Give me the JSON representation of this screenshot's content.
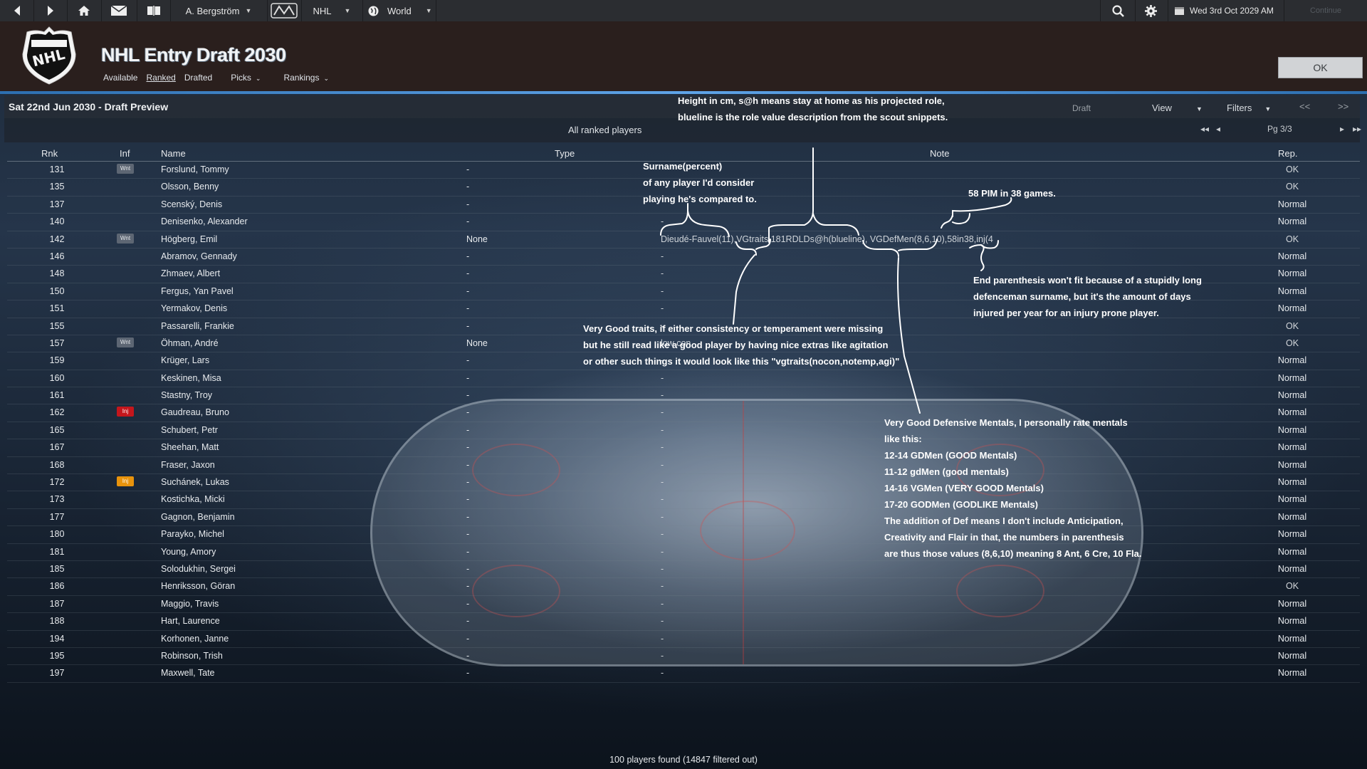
{
  "topbar": {
    "manager": "A. Bergström",
    "league": "NHL",
    "world": "World",
    "date": "Wed 3rd Oct 2029 AM",
    "continue": "Continue"
  },
  "header": {
    "title": "NHL Entry Draft 2030",
    "nav": [
      "Available",
      "Ranked",
      "Drafted",
      "Picks",
      "Rankings"
    ],
    "ok": "OK"
  },
  "panel": {
    "title": "Sat 22nd Jun 2030 - Draft Preview",
    "draft": "Draft",
    "view": "View",
    "filters": "Filters",
    "prev": "<<",
    "next": ">>",
    "subtitle": "All ranked players",
    "page": "Pg 3/3"
  },
  "columns": {
    "rank": "Rnk",
    "inf": "Inf",
    "name": "Name",
    "type": "Type",
    "note": "Note",
    "rep": "Rep."
  },
  "rows": [
    {
      "rank": "131",
      "inf": "Wnt",
      "name": "Forslund, Tommy",
      "type": "-",
      "note": "",
      "rep": "OK"
    },
    {
      "rank": "135",
      "inf": "",
      "name": "Olsson, Benny",
      "type": "-",
      "note": "",
      "rep": "OK"
    },
    {
      "rank": "137",
      "inf": "",
      "name": "Scenský, Denis",
      "type": "-",
      "note": "",
      "rep": "Normal"
    },
    {
      "rank": "140",
      "inf": "",
      "name": "Denisenko, Alexander",
      "type": "-",
      "note": "-",
      "rep": "Normal"
    },
    {
      "rank": "142",
      "inf": "Wnt",
      "name": "Högberg, Emil",
      "type": "None",
      "note": "Dieudé-Fauvel(11),VGtraits,181RDLDs@h(blueline), VGDefMen(8,6,10),58in38,inj(4",
      "rep": "OK"
    },
    {
      "rank": "146",
      "inf": "",
      "name": "Abramov, Gennady",
      "type": "-",
      "note": "-",
      "rep": "Normal"
    },
    {
      "rank": "148",
      "inf": "",
      "name": "Zhmaev, Albert",
      "type": "-",
      "note": "-",
      "rep": "Normal"
    },
    {
      "rank": "150",
      "inf": "",
      "name": "Fergus, Yan Pavel",
      "type": "-",
      "note": "-",
      "rep": "Normal"
    },
    {
      "rank": "151",
      "inf": "",
      "name": "Yermakov, Denis",
      "type": "-",
      "note": "-",
      "rep": "Normal"
    },
    {
      "rank": "155",
      "inf": "",
      "name": "Passarelli, Frankie",
      "type": "-",
      "note": "-",
      "rep": "OK"
    },
    {
      "rank": "157",
      "inf": "Wnt",
      "name": "Öhman, André",
      "type": "None",
      "note": "low con",
      "rep": "OK"
    },
    {
      "rank": "159",
      "inf": "",
      "name": "Krüger, Lars",
      "type": "-",
      "note": "-",
      "rep": "Normal"
    },
    {
      "rank": "160",
      "inf": "",
      "name": "Keskinen, Misa",
      "type": "-",
      "note": "-",
      "rep": "Normal"
    },
    {
      "rank": "161",
      "inf": "",
      "name": "Stastny, Troy",
      "type": "-",
      "note": "-",
      "rep": "Normal"
    },
    {
      "rank": "162",
      "inf": "Inj",
      "name": "Gaudreau, Bruno",
      "type": "-",
      "note": "-",
      "rep": "Normal"
    },
    {
      "rank": "165",
      "inf": "",
      "name": "Schubert, Petr",
      "type": "-",
      "note": "-",
      "rep": "Normal"
    },
    {
      "rank": "167",
      "inf": "",
      "name": "Sheehan, Matt",
      "type": "-",
      "note": "-",
      "rep": "Normal"
    },
    {
      "rank": "168",
      "inf": "",
      "name": "Fraser, Jaxon",
      "type": "-",
      "note": "-",
      "rep": "Normal"
    },
    {
      "rank": "172",
      "inf": "Inj",
      "name": "Suchánek, Lukas",
      "type": "-",
      "note": "-",
      "rep": "Normal"
    },
    {
      "rank": "173",
      "inf": "",
      "name": "Kostichka, Micki",
      "type": "-",
      "note": "-",
      "rep": "Normal"
    },
    {
      "rank": "177",
      "inf": "",
      "name": "Gagnon, Benjamin",
      "type": "-",
      "note": "-",
      "rep": "Normal"
    },
    {
      "rank": "180",
      "inf": "",
      "name": "Parayko, Michel",
      "type": "-",
      "note": "-",
      "rep": "Normal"
    },
    {
      "rank": "181",
      "inf": "",
      "name": "Young, Amory",
      "type": "-",
      "note": "-",
      "rep": "Normal"
    },
    {
      "rank": "185",
      "inf": "",
      "name": "Solodukhin, Sergei",
      "type": "-",
      "note": "-",
      "rep": "Normal"
    },
    {
      "rank": "186",
      "inf": "",
      "name": "Henriksson, Göran",
      "type": "-",
      "note": "-",
      "rep": "OK"
    },
    {
      "rank": "187",
      "inf": "",
      "name": "Maggio, Travis",
      "type": "-",
      "note": "-",
      "rep": "Normal"
    },
    {
      "rank": "188",
      "inf": "",
      "name": "Hart, Laurence",
      "type": "-",
      "note": "-",
      "rep": "Normal"
    },
    {
      "rank": "194",
      "inf": "",
      "name": "Korhonen, Janne",
      "type": "-",
      "note": "-",
      "rep": "Normal"
    },
    {
      "rank": "195",
      "inf": "",
      "name": "Robinson, Trish",
      "type": "-",
      "note": "-",
      "rep": "Normal"
    },
    {
      "rank": "197",
      "inf": "",
      "name": "Maxwell, Tate",
      "type": "-",
      "note": "-",
      "rep": "Normal"
    }
  ],
  "annotations": {
    "height": [
      "Height in cm, s@h means stay at home as his projected role,",
      "blueline  is the role value description from the scout snippets."
    ],
    "surname": [
      "Surname(percent)",
      "of any player I'd consider",
      "playing he's compared to."
    ],
    "pim": "58 PIM in 38 games.",
    "paren": [
      "End parenthesis won't fit because of a stupidly long",
      "defenceman surname, but it's the amount of days",
      "injured per year for an injury prone player."
    ],
    "traits": [
      "Very Good traits, if either consistency or temperament were missing",
      "but he still read like a good player by having nice extras like agitation",
      "or other such things it would look like this \"vgtraits(nocon,notemp,agi)\""
    ],
    "mentals": [
      "Very Good Defensive Mentals, I personally rate mentals",
      "like this:",
      "12-14 GDMen (GOOD Mentals)",
      "11-12  gdMen (good mentals)",
      "14-16 VGMen (VERY GOOD Mentals)",
      "17-20 GODMen (GODLIKE Mentals)",
      "The addition of Def means I don't include Anticipation,",
      "Creativity and Flair in that, the numbers in parenthesis",
      "are thus those values (8,6,10) meaning 8 Ant, 6 Cre, 10 Fla."
    ]
  },
  "footer": "100 players found (14847 filtered out)",
  "colors": {
    "accent": "#5fa4e8",
    "header_bg": "#2a1f1d",
    "injury_red": "#c4161c",
    "injury_orange": "#e8930c"
  }
}
